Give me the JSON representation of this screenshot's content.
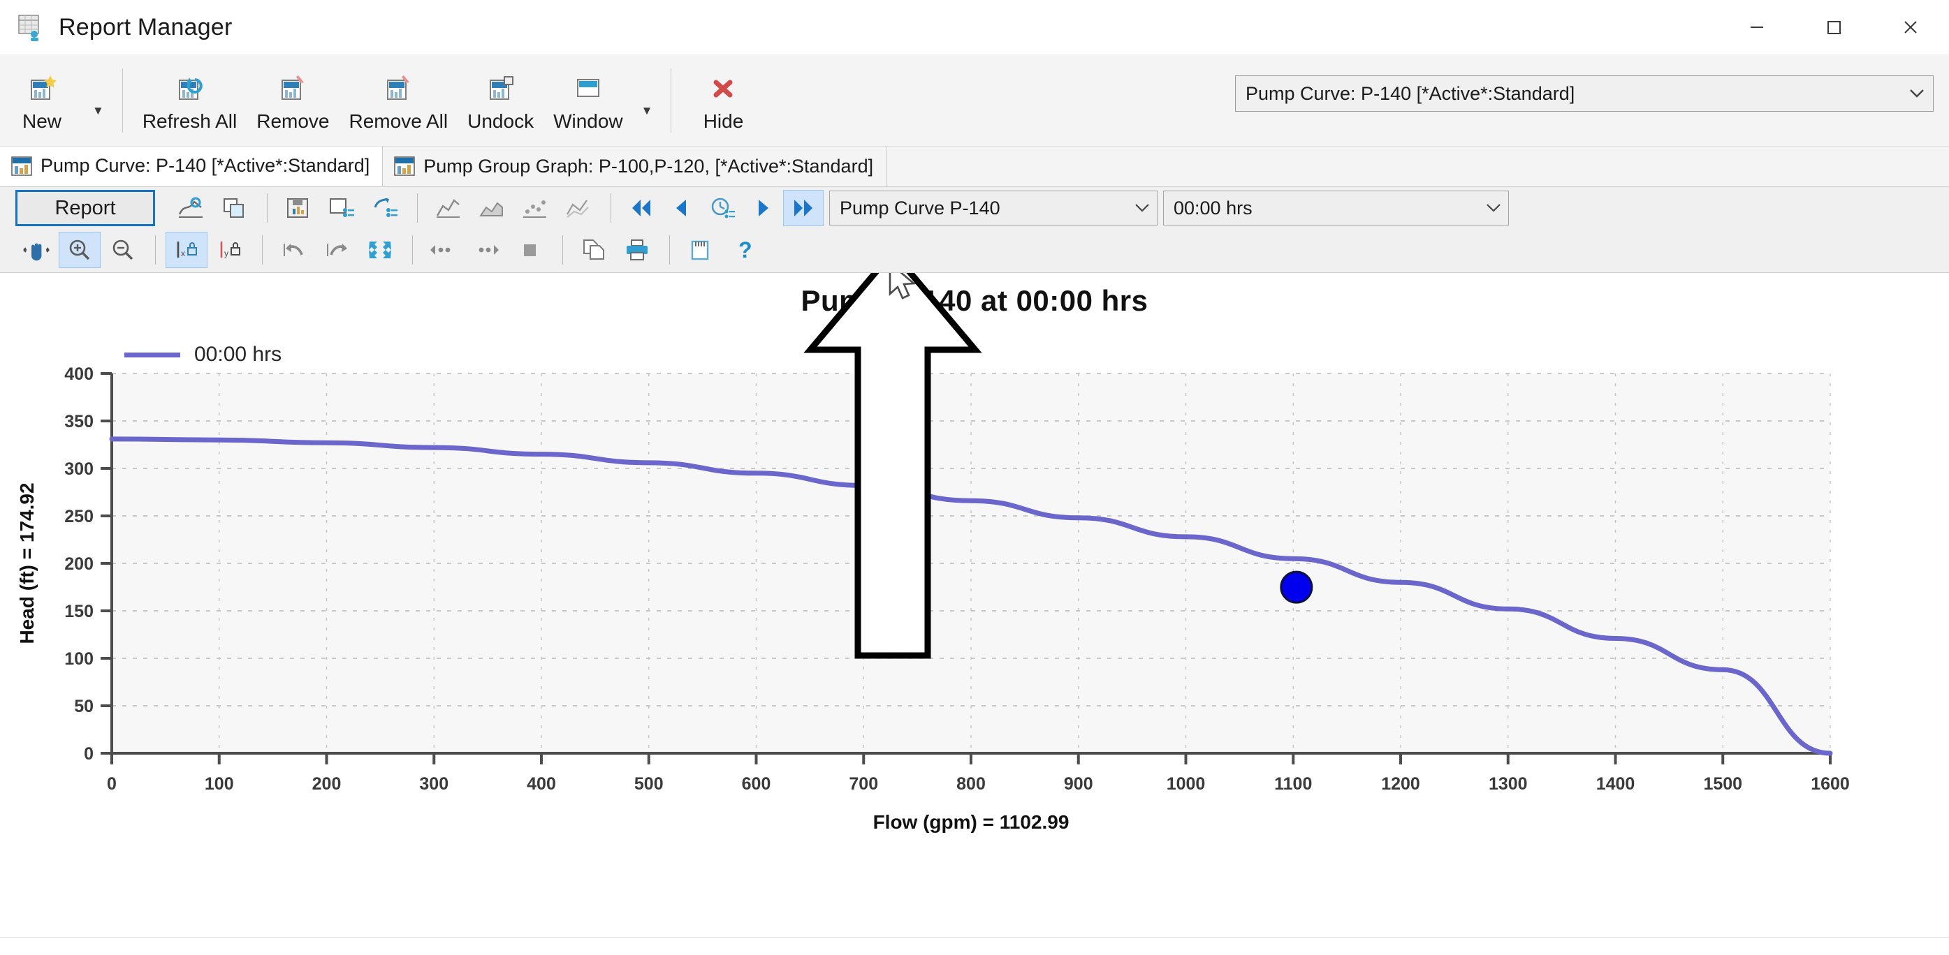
{
  "window": {
    "title": "Report Manager",
    "icon": "report-manager-icon",
    "controls": {
      "minimize": "minimize-icon",
      "maximize": "maximize-icon",
      "close": "close-icon"
    }
  },
  "ribbon": {
    "buttons": [
      {
        "label": "New",
        "icon": "new-report-icon",
        "has_dropdown": true
      },
      {
        "label": "Refresh All",
        "icon": "refresh-all-icon",
        "has_dropdown": false
      },
      {
        "label": "Remove",
        "icon": "remove-icon",
        "has_dropdown": false
      },
      {
        "label": "Remove All",
        "icon": "remove-all-icon",
        "has_dropdown": false
      },
      {
        "label": "Undock",
        "icon": "undock-icon",
        "has_dropdown": false
      },
      {
        "label": "Window",
        "icon": "window-icon",
        "has_dropdown": true
      },
      {
        "label": "Hide",
        "icon": "hide-icon",
        "has_dropdown": false
      }
    ],
    "report_selector": {
      "value": "Pump Curve: P-140 [*Active*:Standard]",
      "arrow": "chevron-down-icon"
    }
  },
  "tabs": [
    {
      "label": "Pump Curve: P-140 [*Active*:Standard]",
      "icon": "chart-tab-icon",
      "active": true
    },
    {
      "label": "Pump Group Graph: P-100,P-120, [*Active*:Standard]",
      "icon": "chart-tab-icon",
      "active": false
    }
  ],
  "graph_toolbar": {
    "report_button": "Report",
    "row1_icons": [
      "graph-series-icon",
      "copy-graph-icon",
      "save-graph-icon",
      "graph-properties-icon",
      "graph-options-icon",
      "chart-line-icon",
      "chart-area-icon",
      "chart-scatter-icon",
      "chart-multi-icon"
    ],
    "nav_icons": [
      "skip-to-first-icon",
      "step-back-icon",
      "time-clock-icon",
      "step-forward-icon",
      "skip-to-last-icon"
    ],
    "nav_highlighted": "skip-to-last-icon",
    "curve_selector": {
      "value": "Pump Curve P-140",
      "arrow": "chevron-down-icon"
    },
    "time_selector": {
      "value": "00:00 hrs",
      "arrow": "chevron-down-icon"
    },
    "row2_icons": [
      "pan-icon",
      "zoom-in-icon",
      "zoom-out-icon",
      "lock-x-axis-icon",
      "lock-y-axis-icon",
      "undo-icon",
      "redo-icon",
      "fit-to-window-icon",
      "scroll-left-icon",
      "scroll-right-icon",
      "stop-icon",
      "copy-icon",
      "print-icon",
      "notes-icon",
      "help-icon"
    ],
    "row2_selected": [
      "zoom-in-icon",
      "lock-x-axis-icon"
    ]
  },
  "chart_data": {
    "type": "line",
    "title": "Pump P-140 at 00:00 hrs",
    "xlabel": "Flow (gpm) = 1102.99",
    "ylabel": "Head (ft) = 174.92",
    "xlim": [
      0,
      1600
    ],
    "ylim": [
      0,
      400
    ],
    "xticks": [
      0,
      100,
      200,
      300,
      400,
      500,
      600,
      700,
      800,
      900,
      1000,
      1100,
      1200,
      1300,
      1400,
      1500,
      1600
    ],
    "yticks": [
      0,
      50,
      100,
      150,
      200,
      250,
      300,
      350,
      400
    ],
    "grid": true,
    "legend_position": "top-left",
    "line_color": "#6a66cc",
    "marker_color": "#0000ee",
    "series": [
      {
        "name": "00:00 hrs",
        "x": [
          0,
          100,
          200,
          300,
          400,
          500,
          600,
          700,
          800,
          900,
          1000,
          1100,
          1200,
          1300,
          1400,
          1500,
          1600
        ],
        "y": [
          331,
          330,
          327,
          322,
          315,
          306,
          295,
          282,
          266,
          248,
          228,
          205,
          180,
          152,
          121,
          88,
          0
        ]
      }
    ],
    "marker": {
      "x": 1102.99,
      "y": 174.92,
      "label": "operating-point"
    }
  },
  "overlay": {
    "arrow": "up-arrow-annotation",
    "cursor": "mouse-pointer"
  }
}
